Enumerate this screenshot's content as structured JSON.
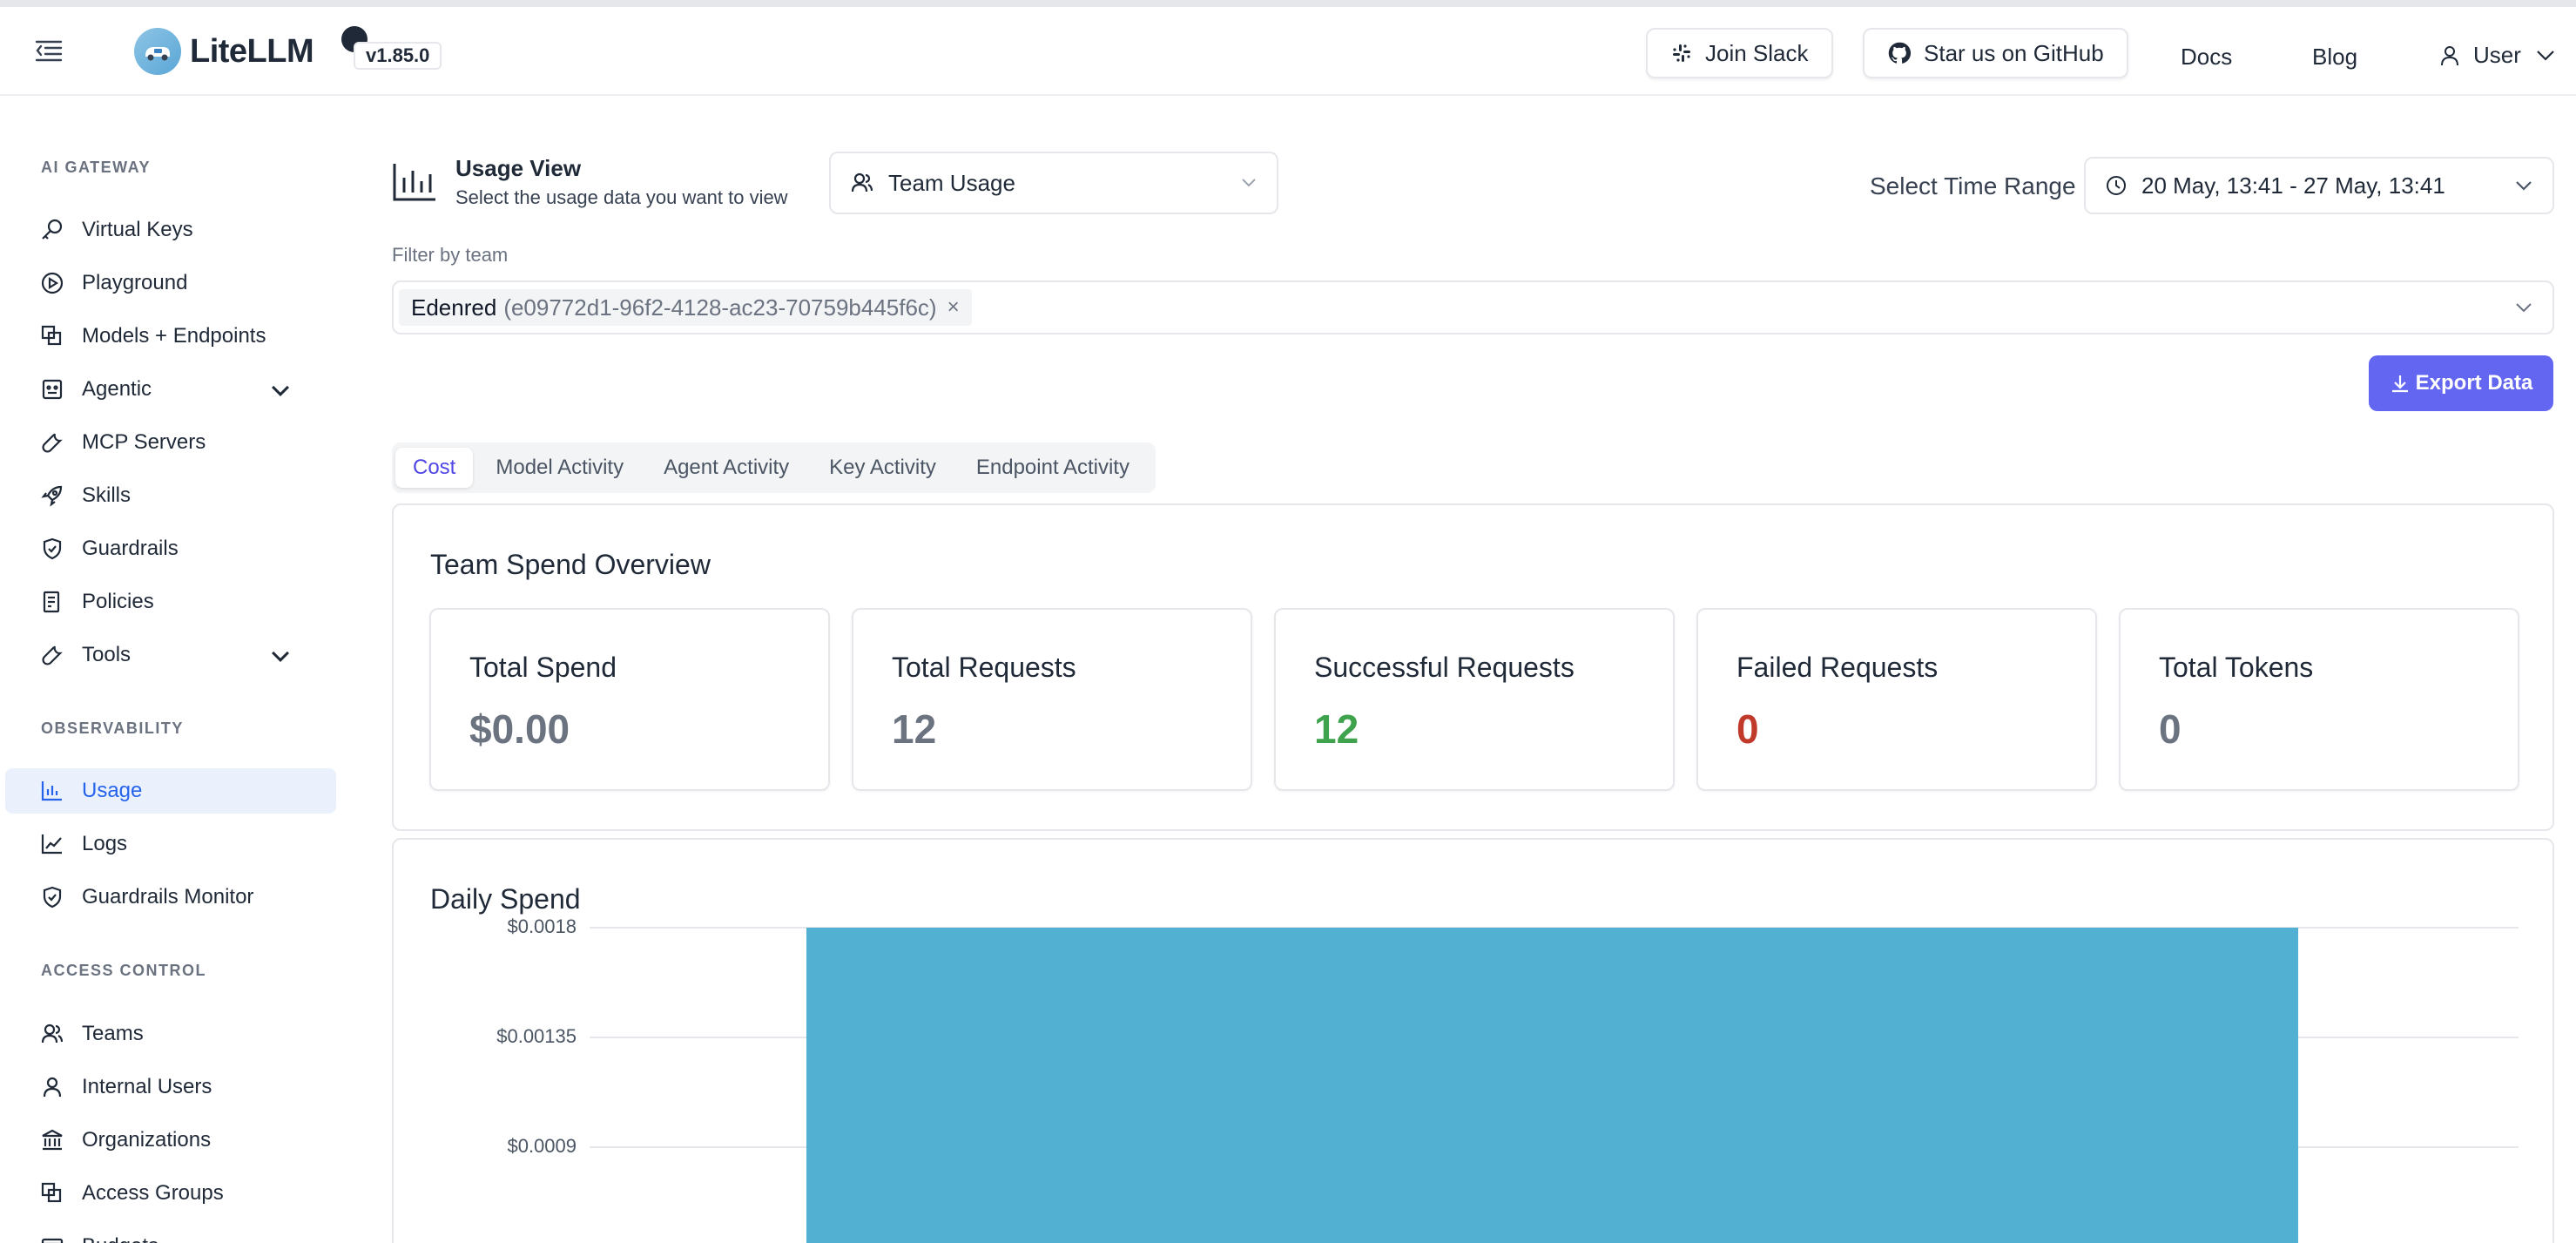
{
  "header": {
    "brand": "LiteLLM",
    "version": "v1.85.0",
    "join_slack": "Join Slack",
    "star_github": "Star us on GitHub",
    "docs": "Docs",
    "blog": "Blog",
    "user": "User"
  },
  "sidebar": {
    "sections": [
      {
        "title": "AI GATEWAY"
      },
      {
        "title": "OBSERVABILITY"
      },
      {
        "title": "ACCESS CONTROL"
      }
    ],
    "items": [
      {
        "label": "Virtual Keys",
        "icon": "key-icon"
      },
      {
        "label": "Playground",
        "icon": "play-circle-icon"
      },
      {
        "label": "Models + Endpoints",
        "icon": "block-icon"
      },
      {
        "label": "Agentic",
        "icon": "robot-icon"
      },
      {
        "label": "MCP Servers",
        "icon": "tool-icon"
      },
      {
        "label": "Skills",
        "icon": "rocket-icon"
      },
      {
        "label": "Guardrails",
        "icon": "shield-check-icon"
      },
      {
        "label": "Policies",
        "icon": "audit-icon"
      },
      {
        "label": "Tools",
        "icon": "tool-icon"
      },
      {
        "label": "Usage",
        "icon": "bar-chart-icon"
      },
      {
        "label": "Logs",
        "icon": "line-chart-icon"
      },
      {
        "label": "Guardrails Monitor",
        "icon": "shield-check-icon"
      },
      {
        "label": "Teams",
        "icon": "team-icon"
      },
      {
        "label": "Internal Users",
        "icon": "user-icon"
      },
      {
        "label": "Organizations",
        "icon": "bank-icon"
      },
      {
        "label": "Access Groups",
        "icon": "block-icon"
      },
      {
        "label": "Budgets",
        "icon": "wallet-icon"
      }
    ]
  },
  "usage_view": {
    "title": "Usage View",
    "subtitle": "Select the usage data you want to view",
    "selected": "Team Usage"
  },
  "time_range": {
    "label": "Select Time Range",
    "value": "20 May, 13:41 - 27 May, 13:41"
  },
  "filter": {
    "label": "Filter by team",
    "tag_name": "Edenred",
    "tag_id": "(e09772d1-96f2-4128-ac23-70759b445f6c)",
    "tag_remove": "×"
  },
  "export_label": "Export Data",
  "tabs": [
    "Cost",
    "Model Activity",
    "Agent Activity",
    "Key Activity",
    "Endpoint Activity"
  ],
  "overview": {
    "title": "Team Spend Overview",
    "stats": [
      {
        "label": "Total Spend",
        "value": "$0.00",
        "color": "#6b7280"
      },
      {
        "label": "Total Requests",
        "value": "12",
        "color": "#6b7280"
      },
      {
        "label": "Successful Requests",
        "value": "12",
        "color": "#3fa34d"
      },
      {
        "label": "Failed Requests",
        "value": "0",
        "color": "#c0392b"
      },
      {
        "label": "Total Tokens",
        "value": "0",
        "color": "#6b7280"
      }
    ]
  },
  "daily_spend": {
    "title": "Daily Spend"
  },
  "chart_data": {
    "type": "bar",
    "title": "Daily Spend",
    "ytick_labels": [
      "$0.0018",
      "$0.00135",
      "$0.0009"
    ],
    "yticks": [
      0.0018,
      0.00135,
      0.0009
    ],
    "ylim": [
      0,
      0.0018
    ],
    "categories": [
      ""
    ],
    "values": [
      0.0018
    ],
    "bar_color": "#52b0d2",
    "grid": true
  }
}
